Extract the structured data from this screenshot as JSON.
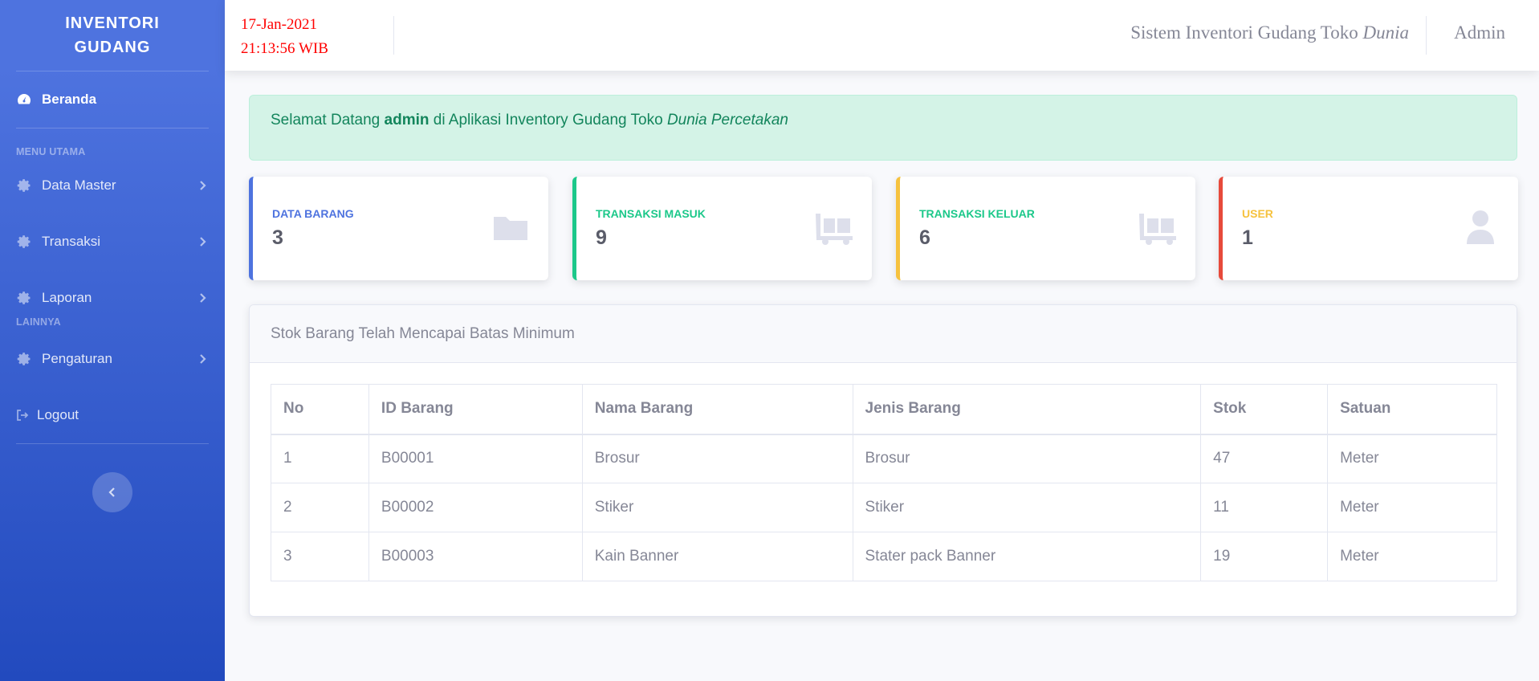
{
  "brand": {
    "line1": "INVENTORI",
    "line2": "GUDANG"
  },
  "sidebar": {
    "home": "Beranda",
    "heading_main": "MENU UTAMA",
    "items": [
      {
        "label": "Data Master",
        "icon": "gear-icon"
      },
      {
        "label": "Transaksi",
        "icon": "gear-icon"
      },
      {
        "label": "Laporan",
        "icon": "gear-icon"
      }
    ],
    "heading_other": "LAINNYA",
    "settings": "Pengaturan",
    "logout": "Logout"
  },
  "topbar": {
    "date": "17-Jan-2021",
    "time": "21:13:56 WIB",
    "system_title": "Sistem Inventori Gudang Toko",
    "system_title_italic": "Dunia",
    "user": "Admin"
  },
  "alert": {
    "prefix": "Selamat Datang",
    "user": "admin",
    "middle": "di Aplikasi Inventory Gudang Toko",
    "store": "Dunia Percetakan"
  },
  "cards": [
    {
      "title": "DATA BARANG",
      "value": "3",
      "color": "#4e73df",
      "icon": "folder-icon"
    },
    {
      "title": "TRANSAKSI MASUK",
      "value": "9",
      "color": "#1cc88a",
      "icon": "dolly-icon"
    },
    {
      "title": "TRANSAKSI KELUAR",
      "value": "6",
      "color": "#1cc88a",
      "icon": "dolly-icon"
    },
    {
      "title": "USER",
      "value": "1",
      "color": "#f6c23e",
      "icon": "user-icon"
    }
  ],
  "card_border_colors": [
    "#4e73df",
    "#1cc88a",
    "#f6c23e",
    "#e74a3b"
  ],
  "panel": {
    "title": "Stok Barang Telah Mencapai Batas Minimum",
    "columns": [
      "No",
      "ID Barang",
      "Nama Barang",
      "Jenis Barang",
      "Stok",
      "Satuan"
    ],
    "rows": [
      [
        "1",
        "B00001",
        "Brosur",
        "Brosur",
        "47",
        "Meter"
      ],
      [
        "2",
        "B00002",
        "Stiker",
        "Stiker",
        "11",
        "Meter"
      ],
      [
        "3",
        "B00003",
        "Kain Banner",
        "Stater pack Banner",
        "19",
        "Meter"
      ]
    ]
  }
}
